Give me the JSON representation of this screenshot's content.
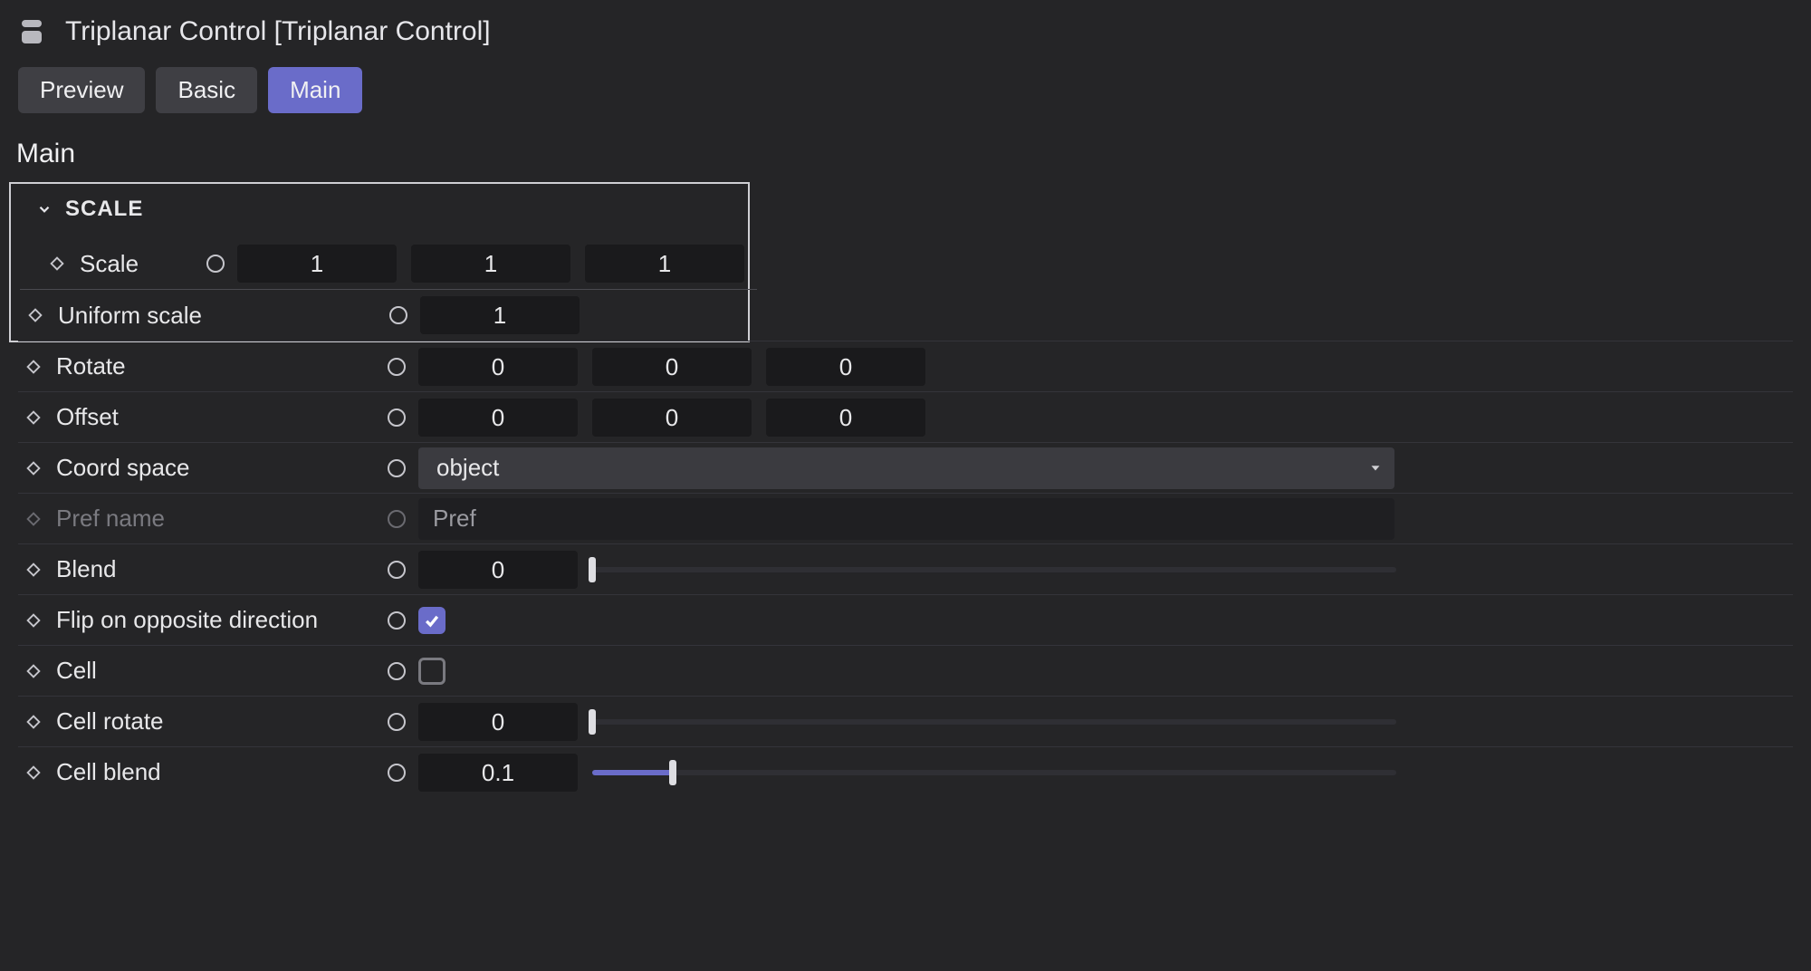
{
  "header": {
    "title": "Triplanar Control [Triplanar Control]"
  },
  "tabs": {
    "preview": "Preview",
    "basic": "Basic",
    "main": "Main",
    "active": "main"
  },
  "section": {
    "title": "Main"
  },
  "group_scale": {
    "label": "SCALE",
    "expanded": true
  },
  "params": {
    "scale": {
      "label": "Scale",
      "x": "1",
      "y": "1",
      "z": "1"
    },
    "uniform_scale": {
      "label": "Uniform scale",
      "value": "1"
    },
    "rotate": {
      "label": "Rotate",
      "x": "0",
      "y": "0",
      "z": "0"
    },
    "offset": {
      "label": "Offset",
      "x": "0",
      "y": "0",
      "z": "0"
    },
    "coord_space": {
      "label": "Coord space",
      "value": "object"
    },
    "pref_name": {
      "label": "Pref name",
      "placeholder": "Pref"
    },
    "blend": {
      "label": "Blend",
      "value": "0",
      "fill_pct": 0,
      "thumb_pct": 0
    },
    "flip": {
      "label": "Flip on opposite direction",
      "checked": true
    },
    "cell": {
      "label": "Cell",
      "checked": false
    },
    "cell_rotate": {
      "label": "Cell rotate",
      "value": "0",
      "fill_pct": 0,
      "thumb_pct": 0
    },
    "cell_blend": {
      "label": "Cell blend",
      "value": "0.1",
      "fill_pct": 10,
      "thumb_pct": 10
    }
  }
}
